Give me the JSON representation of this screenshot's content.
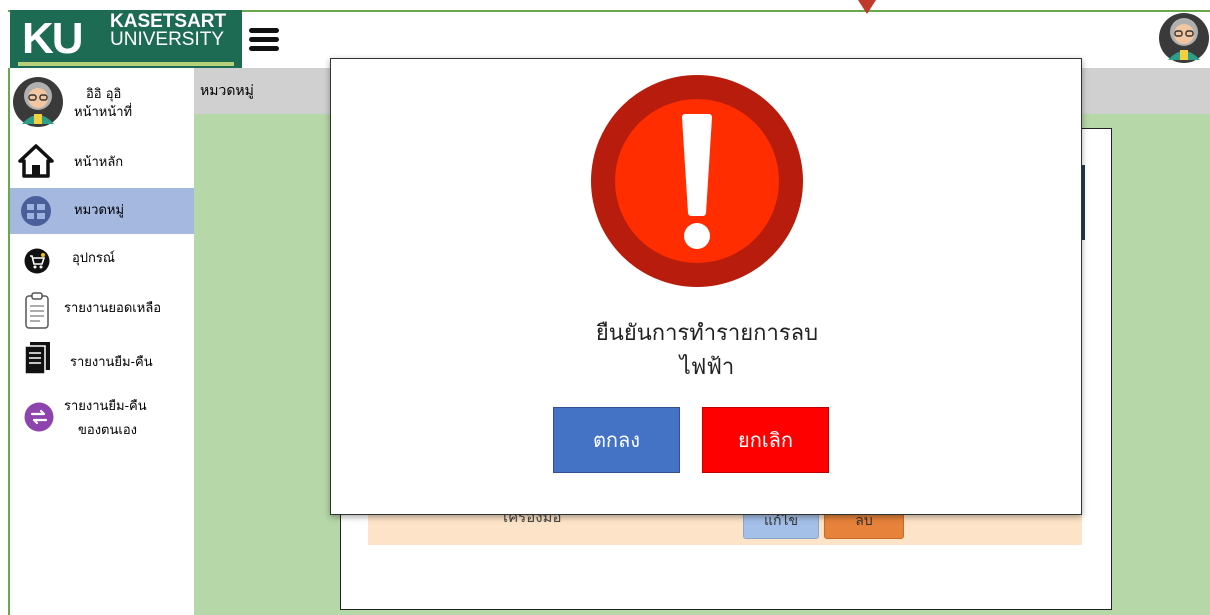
{
  "header": {
    "logo_mark": "KU",
    "logo_line1": "KASETSART",
    "logo_line2": "UNIVERSITY",
    "menu_icon": "hamburger-icon",
    "avatar_icon": "user-avatar-icon"
  },
  "user": {
    "name": "อิอิ อุอิ",
    "role": "หน้าหน้าที่"
  },
  "sidebar": {
    "items": [
      {
        "label": "หน้าหลัก",
        "icon": "home-icon"
      },
      {
        "label": "หมวดหมู่",
        "icon": "category-icon",
        "active": true
      },
      {
        "label": "อุปกรณ์",
        "icon": "cart-icon"
      },
      {
        "label": "รายงานยอดเหลือ",
        "icon": "clipboard-icon"
      },
      {
        "label": "รายงานยืม-คืน",
        "icon": "documents-icon"
      },
      {
        "label_line1": "รายงานยืม-คืน",
        "label_line2": "ของตนเอง",
        "icon": "swap-icon"
      }
    ]
  },
  "breadcrumb": "หมวดหมู่",
  "background_table": {
    "row_name": "เครื่องมือ",
    "edit_label": "แก้ไข",
    "delete_label": "ลบ"
  },
  "modal": {
    "icon": "warning-exclamation-icon",
    "line1": "ยืนยันการทำรายการลบ",
    "line2": "ไฟฟ้า",
    "ok_label": "ตกลง",
    "cancel_label": "ยกเลิก"
  },
  "colors": {
    "brand_green": "#1e6b54",
    "content_green": "#b6d7a8",
    "active_nav": "#a4b8e0",
    "ok_blue": "#4472c4",
    "cancel_red": "#ff0000",
    "warning_dark": "#b71c0c",
    "warning_light": "#ff2d00"
  }
}
